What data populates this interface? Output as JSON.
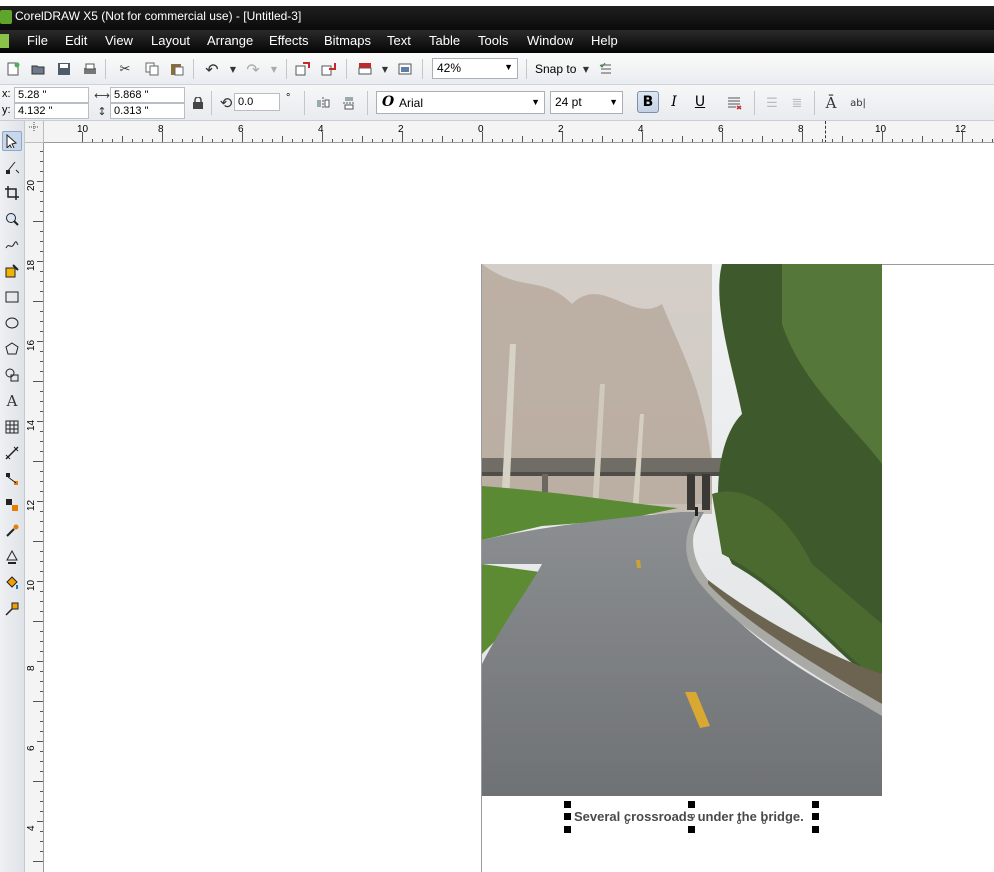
{
  "window": {
    "title": "CorelDRAW X5 (Not for commercial use) - [Untitled-3]"
  },
  "menu": [
    "File",
    "Edit",
    "View",
    "Layout",
    "Arrange",
    "Effects",
    "Bitmaps",
    "Text",
    "Table",
    "Tools",
    "Window",
    "Help"
  ],
  "toolbar": {
    "zoom": "42%",
    "snap_to": "Snap to",
    "icons": [
      "new-document-icon",
      "open-icon",
      "save-icon",
      "print-icon",
      "cut-icon",
      "copy-icon",
      "paste-icon",
      "undo-icon",
      "redo-icon",
      "import-icon",
      "export-icon",
      "application-launcher-icon",
      "welcome-screen-icon",
      "snap-options-icon"
    ]
  },
  "properties": {
    "x_label": "x:",
    "x_value": "5.28 \"",
    "y_label": "y:",
    "y_value": "4.132 \"",
    "width_value": "5.868 \"",
    "height_value": "0.313 \"",
    "rotation": "0.0",
    "rotation_unit": "°",
    "font": "Arial",
    "font_size": "24 pt",
    "bold_active": true
  },
  "rulers": {
    "horizontal": [
      "10",
      "8",
      "6",
      "4",
      "2",
      "0",
      "2",
      "4",
      "6",
      "8",
      "10",
      "12"
    ],
    "vertical": [
      "20",
      "18",
      "16",
      "14",
      "12",
      "10",
      "8",
      "6",
      "4"
    ]
  },
  "tools": [
    "pick-tool-icon",
    "shape-tool-icon",
    "crop-tool-icon",
    "zoom-tool-icon",
    "freehand-tool-icon",
    "smart-fill-icon",
    "rectangle-tool-icon",
    "ellipse-tool-icon",
    "polygon-tool-icon",
    "basic-shapes-icon",
    "text-tool-icon",
    "table-tool-icon",
    "dimension-tool-icon",
    "connector-tool-icon",
    "blend-tool-icon",
    "eyedropper-tool-icon",
    "outline-tool-icon",
    "fill-tool-icon",
    "interactive-fill-icon"
  ],
  "canvas": {
    "caption": "Several crossroads under the bridge."
  }
}
